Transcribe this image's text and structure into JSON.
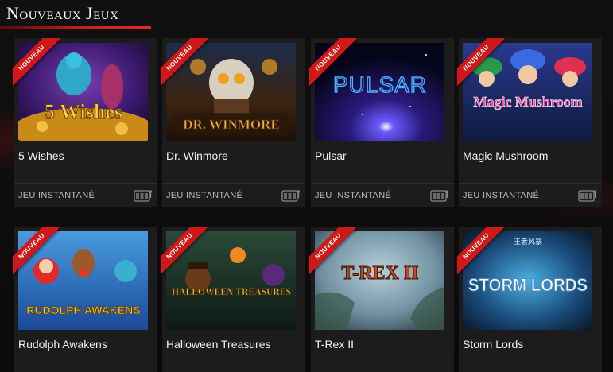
{
  "section": {
    "title": "Nouveaux Jeux"
  },
  "games": [
    {
      "name": "5 Wishes",
      "badge": "NOUVEAU",
      "type": "JEU INSTANTANÉ",
      "art_text": "5 Wishes",
      "icon": "slot-machine-icon",
      "colors": [
        "#3a1a6e",
        "#e0a020"
      ]
    },
    {
      "name": "Dr. Winmore",
      "badge": "NOUVEAU",
      "type": "JEU INSTANTANÉ",
      "art_text": "DR. WINMORE",
      "icon": "slot-machine-icon",
      "colors": [
        "#3b2410",
        "#e8a030"
      ]
    },
    {
      "name": "Pulsar",
      "badge": "NOUVEAU",
      "type": "JEU INSTANTANÉ",
      "art_text": "PULSAR",
      "icon": "slot-machine-icon",
      "colors": [
        "#0a0a2e",
        "#3a8cff"
      ]
    },
    {
      "name": "Magic Mushroom",
      "badge": "NOUVEAU",
      "type": "JEU INSTANTANÉ",
      "art_text": "Magic Mushroom",
      "icon": "slot-machine-icon",
      "colors": [
        "#1a2a6e",
        "#e03050"
      ]
    },
    {
      "name": "Rudolph Awakens",
      "badge": "NOUVEAU",
      "type": "",
      "art_text": "RUDOLPH AWAKENS",
      "icon": "",
      "colors": [
        "#2a70c8",
        "#f0c020"
      ]
    },
    {
      "name": "Halloween Treasures",
      "badge": "NOUVEAU",
      "type": "",
      "art_text": "HALLOWEEN TREASURES",
      "icon": "",
      "colors": [
        "#1c3a2a",
        "#f08a20"
      ]
    },
    {
      "name": "T-Rex II",
      "badge": "NOUVEAU",
      "type": "",
      "art_text": "T-REX II",
      "icon": "",
      "colors": [
        "#6f8fa0",
        "#d04818"
      ]
    },
    {
      "name": "Storm Lords",
      "badge": "NOUVEAU",
      "type": "",
      "art_text": "STORM LORDS",
      "art_subtext": "王者风暴",
      "icon": "",
      "colors": [
        "#1a4a7a",
        "#c8e8ff"
      ]
    }
  ]
}
